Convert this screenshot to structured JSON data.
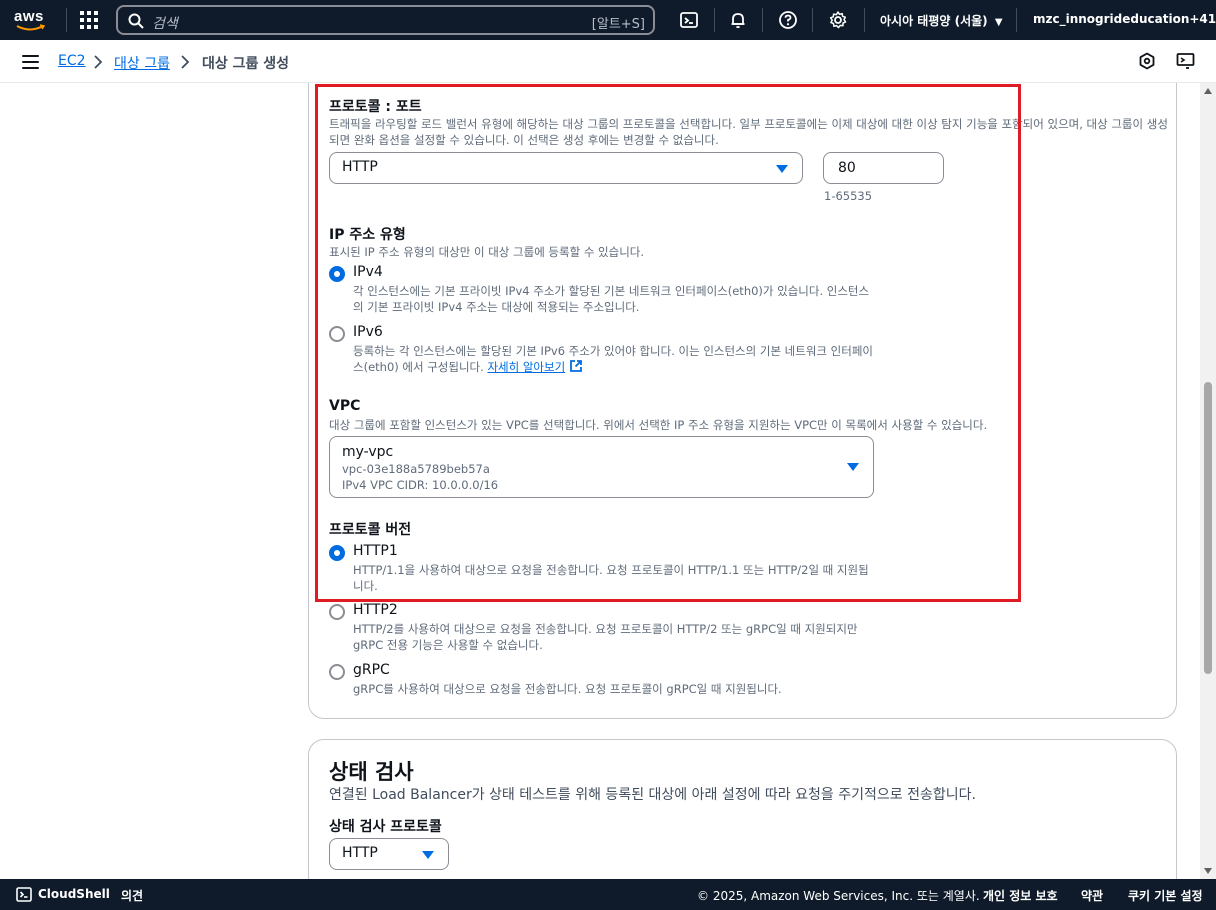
{
  "topnav": {
    "logo": "aws",
    "search_placeholder": "검색",
    "search_shortcut": "[알트+S]",
    "region": "아시아 태평양 (서울)",
    "account": "mzc_innogrideducation+41"
  },
  "breadcrumb": {
    "items": [
      "EC2",
      "대상 그룹"
    ],
    "current": "대상 그룹 생성"
  },
  "protocol_port": {
    "label": "프로토콜 : 포트",
    "description": "트래픽을 라우팅할 로드 밸런서 유형에 해당하는 대상 그룹의 프로토콜을 선택합니다. 일부 프로토콜에는 이제 대상에 대한 이상 탐지 기능을 포함되어 있으며, 대상 그룹이 생성되면 완화 옵션을 설정할 수 있습니다. 이 선택은 생성 후에는 변경할 수 없습니다.",
    "protocol_value": "HTTP",
    "port_value": "80",
    "port_hint": "1-65535"
  },
  "ip_type": {
    "label": "IP 주소 유형",
    "description": "표시된 IP 주소 유형의 대상만 이 대상 그룹에 등록할 수 있습니다.",
    "options": [
      {
        "label": "IPv4",
        "selected": true,
        "desc": "각 인스턴스에는 기본 프라이빗 IPv4 주소가 할당된 기본 네트워크 인터페이스(eth0)가 있습니다. 인스턴스의 기본 프라이빗 IPv4 주소는 대상에 적용되는 주소입니다."
      },
      {
        "label": "IPv6",
        "selected": false,
        "desc": "등록하는 각 인스턴스에는 할당된 기본 IPv6 주소가 있어야 합니다. 이는 인스턴스의 기본 네트워크 인터페이스(eth0) 에서 구성됩니다.",
        "link": "자세히 알아보기"
      }
    ]
  },
  "vpc": {
    "label": "VPC",
    "description": "대상 그룹에 포함할 인스턴스가 있는 VPC를 선택합니다. 위에서 선택한 IP 주소 유형을 지원하는 VPC만 이 목록에서 사용할 수 있습니다.",
    "name": "my-vpc",
    "id": "vpc-03e188a5789beb57a",
    "cidr": "IPv4 VPC CIDR: 10.0.0.0/16"
  },
  "protocol_version": {
    "label": "프로토콜 버전",
    "options": [
      {
        "label": "HTTP1",
        "selected": true,
        "desc": "HTTP/1.1을 사용하여 대상으로 요청을 전송합니다. 요청 프로토콜이 HTTP/1.1 또는 HTTP/2일 때 지원됩니다."
      },
      {
        "label": "HTTP2",
        "selected": false,
        "desc": "HTTP/2를 사용하여 대상으로 요청을 전송합니다. 요청 프로토콜이 HTTP/2 또는 gRPC일 때 지원되지만 gRPC 전용 기능은 사용할 수 없습니다."
      },
      {
        "label": "gRPC",
        "selected": false,
        "desc": "gRPC를 사용하여 대상으로 요청을 전송합니다. 요청 프로토콜이 gRPC일 때 지원됩니다."
      }
    ]
  },
  "health_check": {
    "title": "상태 검사",
    "description": "연결된 Load Balancer가 상태 테스트를 위해 등록된 대상에 아래 설정에 따라 요청을 주기적으로 전송합니다.",
    "protocol_label": "상태 검사 프로토콜",
    "protocol_value": "HTTP"
  },
  "footer": {
    "cloudshell": "CloudShell",
    "feedback": "의견",
    "copyright": "© 2025, Amazon Web Services, Inc. 또는 계열사.",
    "privacy": "개인 정보 보호",
    "terms": "약관",
    "cookies": "쿠키 기본 설정"
  },
  "colors": {
    "nav_bg": "#0f1b2a",
    "link": "#006ce0",
    "highlight": "#e01b24"
  }
}
